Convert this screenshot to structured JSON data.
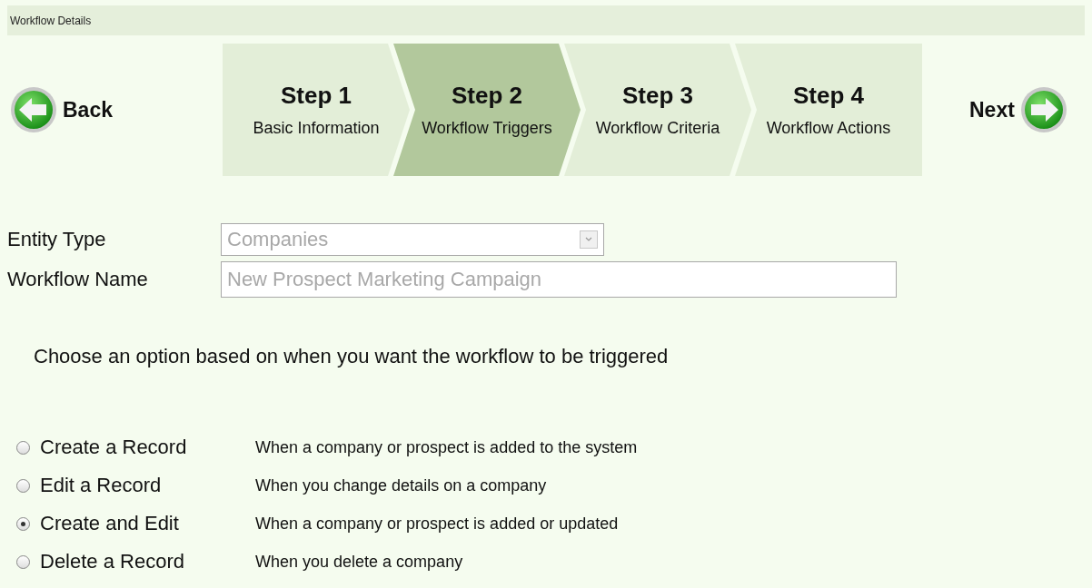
{
  "header": {
    "title": "Workflow Details"
  },
  "nav": {
    "back": "Back",
    "next": "Next"
  },
  "steps": [
    {
      "title": "Step 1",
      "label": "Basic Information",
      "selected": false
    },
    {
      "title": "Step 2",
      "label": "Workflow Triggers",
      "selected": true
    },
    {
      "title": "Step 3",
      "label": "Workflow Criteria",
      "selected": false
    },
    {
      "title": "Step 4",
      "label": "Workflow Actions",
      "selected": false
    }
  ],
  "form": {
    "entity_type": {
      "label": "Entity Type",
      "value": "Companies",
      "disabled": true
    },
    "workflow_name": {
      "label": "Workflow Name",
      "value": "New Prospect Marketing Campaign",
      "disabled": true
    }
  },
  "prompt": "Choose an option based on when you want the workflow to be triggered",
  "options": [
    {
      "label": "Create a Record",
      "description": "When a company or prospect is added to the system",
      "selected": false
    },
    {
      "label": "Edit a Record",
      "description": "When you change details on a company",
      "selected": false
    },
    {
      "label": "Create and Edit",
      "description": "When a company or prospect is added or updated",
      "selected": true
    },
    {
      "label": "Delete a Record",
      "description": "When you delete a company",
      "selected": false
    }
  ]
}
